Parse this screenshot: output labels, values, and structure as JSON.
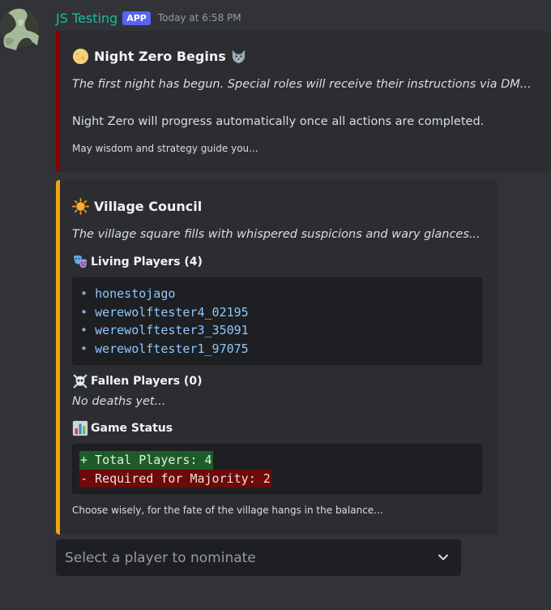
{
  "header": {
    "username": "JS Testing",
    "badge": "APP",
    "timestamp": "Today at 6:58 PM"
  },
  "embed_night": {
    "title": "Night Zero Begins",
    "title_emoji_left": "full-moon-icon",
    "title_emoji_right": "wolf-icon",
    "description": "The first night has begun. Special roles will receive their instructions via DM...",
    "body": "Night Zero will progress automatically once all actions are completed.",
    "footer": "May wisdom and strategy guide you...",
    "accent_color": "#8b0000"
  },
  "embed_council": {
    "title": "Village Council",
    "title_emoji": "sun-icon",
    "description": "The village square fills with whispered suspicions and wary glances...",
    "accent_color": "#f1a512",
    "living": {
      "label": "Living Players (4)",
      "emoji": "theater-masks-icon",
      "bullet": "•",
      "players": [
        "honestojago",
        "werewolftester4_02195",
        "werewolftester3_35091",
        "werewolftester1_97075"
      ]
    },
    "fallen": {
      "label": "Fallen Players (0)",
      "emoji": "skull-crossbones-icon",
      "text": "No deaths yet..."
    },
    "status": {
      "label": "Game Status",
      "emoji": "bar-chart-icon",
      "add_line": "+ Total Players: 4",
      "remove_line": "- Required for Majority: 2"
    },
    "footer": "Choose wisely, for the fate of the village hangs in the balance..."
  },
  "select": {
    "placeholder": "Select a player to nominate"
  }
}
